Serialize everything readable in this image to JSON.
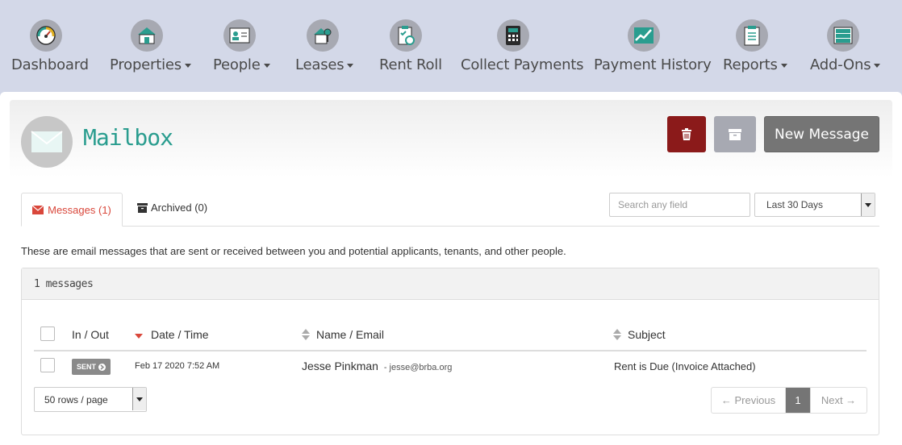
{
  "nav": {
    "items": [
      {
        "label": "Dashboard",
        "icon": "gauge-icon",
        "caret": false
      },
      {
        "label": "Properties",
        "icon": "house-icon",
        "caret": true
      },
      {
        "label": "People",
        "icon": "id-card-icon",
        "caret": true
      },
      {
        "label": "Leases",
        "icon": "house-key-icon",
        "caret": true
      },
      {
        "label": "Rent Roll",
        "icon": "clipboard-clock-icon",
        "caret": false
      },
      {
        "label": "Collect Payments",
        "icon": "calculator-icon",
        "caret": false
      },
      {
        "label": "Payment History",
        "icon": "line-chart-icon",
        "caret": false
      },
      {
        "label": "Reports",
        "icon": "document-icon",
        "caret": true
      },
      {
        "label": "Add-Ons",
        "icon": "drawers-icon",
        "caret": true
      }
    ]
  },
  "header": {
    "title": "Mailbox",
    "new_message_label": "New Message"
  },
  "tabs": {
    "messages_label": "Messages (1)",
    "archived_label": "Archived (0)"
  },
  "filters": {
    "search_placeholder": "Search any field",
    "date_range": "Last 30 Days"
  },
  "description": "These are email messages that are sent or received between you and potential applicants, tenants, and other people.",
  "table": {
    "count_label": "1 messages",
    "columns": [
      "In / Out",
      "Date / Time",
      "Name / Email",
      "Subject"
    ],
    "rows": [
      {
        "direction": "SENT",
        "datetime": "Feb 17 2020 7:52 AM",
        "name": "Jesse Pinkman",
        "email": "- jesse@brba.org",
        "subject": "Rent is Due (Invoice Attached)"
      }
    ]
  },
  "pagination": {
    "rows_per_page": "50 rows / page",
    "previous": "← Previous",
    "current": "1",
    "next": "Next →"
  },
  "colors": {
    "accent": "#2a9d8f",
    "danger": "#8b1a1a",
    "tab_active": "#d9473b",
    "nav_bg": "#d3d8e8"
  }
}
